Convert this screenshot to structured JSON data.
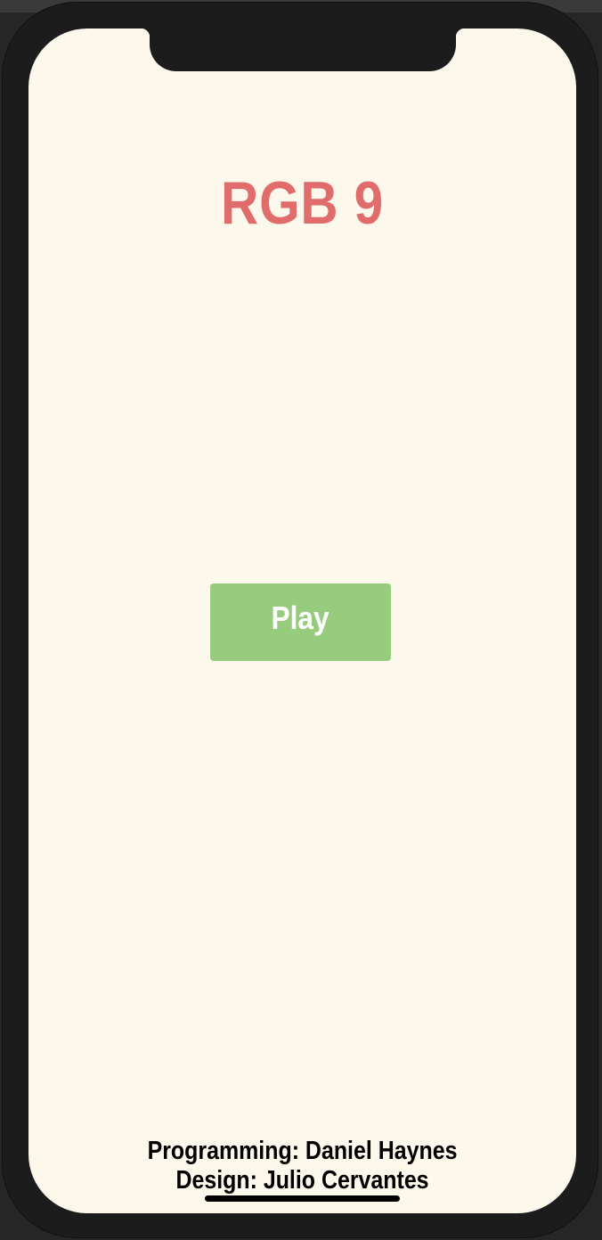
{
  "app": {
    "title": "RGB 9",
    "play_label": "Play",
    "credits": {
      "programming": "Programming: Daniel Haynes",
      "design": "Design: Julio Cervantes"
    }
  },
  "colors": {
    "background": "#fdf8ec",
    "title": "#e06c6c",
    "play_button": "#97cc7f",
    "play_text": "#ffffff",
    "credits_text": "#000000",
    "device_frame": "#1c1c1c"
  }
}
